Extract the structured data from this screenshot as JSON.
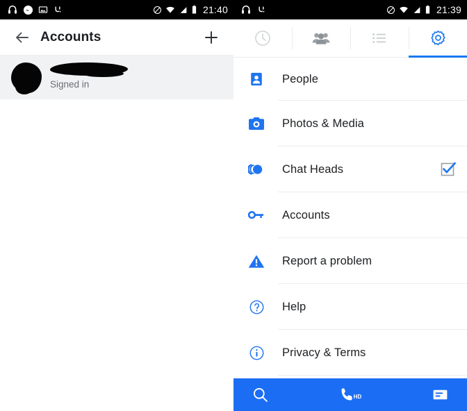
{
  "left_panel": {
    "statusbar": {
      "notification_icons": [
        "headphones-icon",
        "messenger-icon",
        "screenshot-icon",
        "sync-icon"
      ],
      "system_icons": [
        "do-not-disturb-icon",
        "wifi-icon",
        "signal-icon",
        "battery-icon"
      ],
      "time": "21:40"
    },
    "appbar": {
      "back_icon": "back-arrow-icon",
      "title": "Accounts",
      "add_icon": "plus-icon"
    },
    "account": {
      "name": "",
      "status": "Signed in",
      "redacted": "true"
    }
  },
  "right_panel": {
    "statusbar": {
      "notification_icons": [
        "headphones-icon",
        "sync-icon"
      ],
      "system_icons": [
        "do-not-disturb-icon",
        "wifi-icon",
        "signal-icon",
        "battery-icon"
      ],
      "time": "21:39"
    },
    "tabs": [
      {
        "name": "recents",
        "icon": "clock-icon",
        "active": false
      },
      {
        "name": "people",
        "icon": "people-group-icon",
        "active": false
      },
      {
        "name": "groups",
        "icon": "list-icon",
        "active": false
      },
      {
        "name": "settings",
        "icon": "gear-icon",
        "active": true
      }
    ],
    "settings": [
      {
        "label": "People",
        "icon": "contact-card-icon",
        "checkbox": false
      },
      {
        "label": "Photos & Media",
        "icon": "camera-icon",
        "checkbox": false
      },
      {
        "label": "Chat Heads",
        "icon": "chat-heads-icon",
        "checkbox": true,
        "checked": true
      },
      {
        "label": "Accounts",
        "icon": "key-icon",
        "checkbox": false
      },
      {
        "label": "Report a problem",
        "icon": "warning-triangle-icon",
        "checkbox": false
      },
      {
        "label": "Help",
        "icon": "question-circle-icon",
        "checkbox": false
      },
      {
        "label": "Privacy & Terms",
        "icon": "info-circle-icon",
        "checkbox": false
      }
    ],
    "bottombar": {
      "search_icon": "search-icon",
      "call_icon": "phone-hd-icon",
      "call_badge": "HD",
      "message_icon": "message-icon"
    }
  },
  "colors": {
    "accent": "#1877f2",
    "bottom_bar": "#1b6ef3",
    "status_bar": "#000000",
    "row_highlight": "#f1f2f3"
  }
}
